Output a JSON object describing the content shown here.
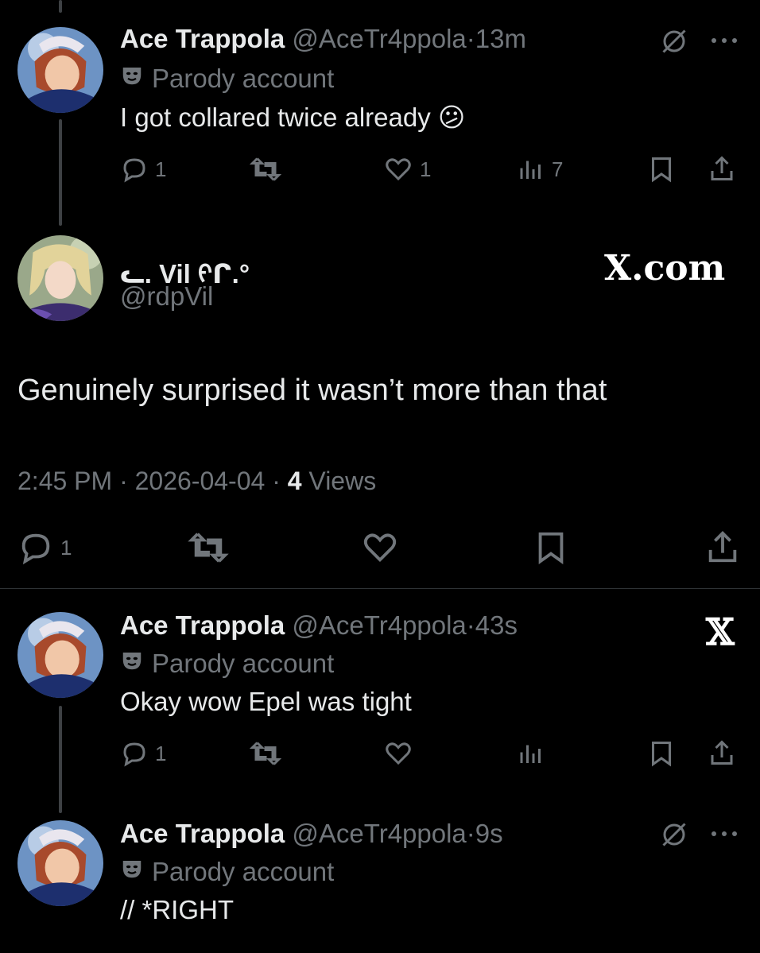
{
  "tweet1": {
    "name": "Ace Trappola",
    "handle": "@AceTr4ppola",
    "sep": "·",
    "time": "13m",
    "badge": "Parody account",
    "text": "I got collared twice already",
    "emoji": "😕",
    "reply_count": "1",
    "like_count": "1",
    "view_count": "7"
  },
  "focused": {
    "name": "ᓚ. Vil ᠻᒋ.°",
    "handle": "@rdpVil",
    "watermark": "X.com",
    "text": "Genuinely surprised it wasn’t more than that",
    "timestamp": "2:45 PM · 2026-04-04 · ",
    "views_count": "4",
    "views_label": " Views",
    "reply_count": "1"
  },
  "tweet2": {
    "name": "Ace Trappola",
    "handle": "@AceTr4ppola",
    "sep": "·",
    "time": "43s",
    "badge": "Parody account",
    "text": "Okay wow Epel was tight",
    "reply_count": "1"
  },
  "tweet3": {
    "name": "Ace Trappola",
    "handle": "@AceTr4ppola",
    "sep": "·",
    "time": "9s",
    "badge": "Parody account",
    "text": "// *RIGHT"
  },
  "colors": {
    "background": "#000000",
    "text": "#e7e9ea",
    "muted": "#71767b",
    "divider": "#2f3336"
  }
}
